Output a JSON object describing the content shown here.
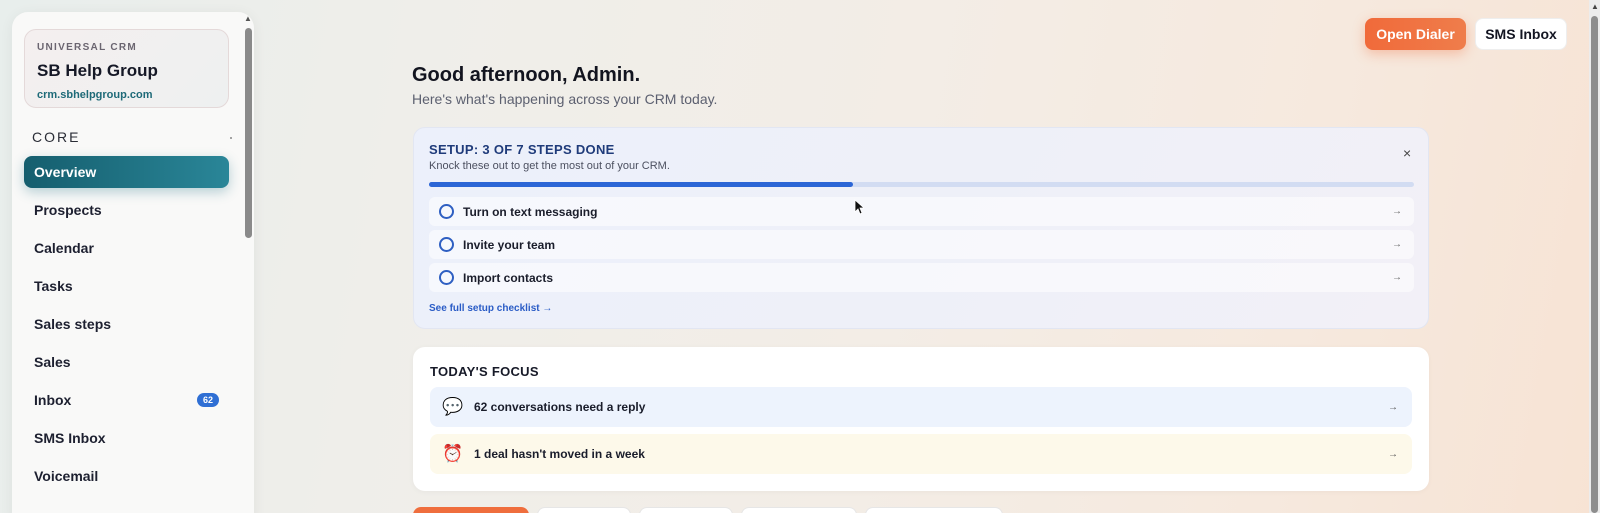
{
  "sidebar": {
    "brand": {
      "kicker": "UNIVERSAL CRM",
      "name": "SB Help Group",
      "url": "crm.sbhelpgroup.com"
    },
    "section_label": "CORE",
    "items": [
      {
        "label": "Overview",
        "active": true
      },
      {
        "label": "Prospects"
      },
      {
        "label": "Calendar"
      },
      {
        "label": "Tasks"
      },
      {
        "label": "Sales steps"
      },
      {
        "label": "Sales"
      },
      {
        "label": "Inbox",
        "badge": "62"
      },
      {
        "label": "SMS Inbox"
      },
      {
        "label": "Voicemail"
      }
    ]
  },
  "header": {
    "open_dialer": "Open Dialer",
    "sms_inbox": "SMS Inbox"
  },
  "greeting": {
    "title": "Good afternoon, Admin.",
    "subtitle": "Here's what's happening across your CRM today."
  },
  "setup": {
    "title": "SETUP: 3 OF 7 STEPS DONE",
    "subtitle": "Knock these out to get the most out of your CRM.",
    "progress_fraction": 0.43,
    "close_icon": "×",
    "steps": [
      {
        "label": "Turn on text messaging",
        "arrow": "→"
      },
      {
        "label": "Invite your team",
        "arrow": "→"
      },
      {
        "label": "Import contacts",
        "arrow": "→"
      }
    ],
    "checklist_link": "See full setup checklist →"
  },
  "focus": {
    "title": "TODAY'S FOCUS",
    "items": [
      {
        "icon": "💬",
        "icon_name": "chat-bubble-icon",
        "label": "62 conversations need a reply",
        "arrow": "→"
      },
      {
        "icon": "⏰",
        "icon_name": "alarm-clock-icon",
        "label": "1 deal hasn't moved in a week",
        "arrow": "→"
      }
    ]
  },
  "colors": {
    "accent_teal": "#1a6e80",
    "accent_orange": "#f06a3a",
    "progress_blue": "#2c66d6",
    "badge_blue": "#2f6fd4"
  }
}
